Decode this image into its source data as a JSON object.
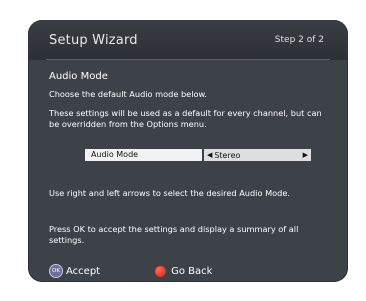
{
  "header": {
    "title": "Setup Wizard",
    "step": "Step 2 of 2"
  },
  "content": {
    "section_title": "Audio Mode",
    "line1": "Choose the default Audio mode below.",
    "line2": "These settings will be used as a default for every channel, but can be overridden from the Options menu.",
    "setting": {
      "label": "Audio Mode",
      "value": "Stereo"
    },
    "line3": "Use right and left arrows to select the desired Audio Mode.",
    "line4": "Press OK to accept the settings and display a summary of all settings."
  },
  "footer": {
    "ok_icon_text": "OK",
    "accept": "Accept",
    "go_back": "Go Back"
  },
  "colors": {
    "background": "#3d4148",
    "header": "#2d3035",
    "ok_button": "#6b6f9e",
    "red_button": "#d21d0f"
  },
  "icons": {
    "left": "triangle-left-icon",
    "right": "triangle-right-icon"
  }
}
